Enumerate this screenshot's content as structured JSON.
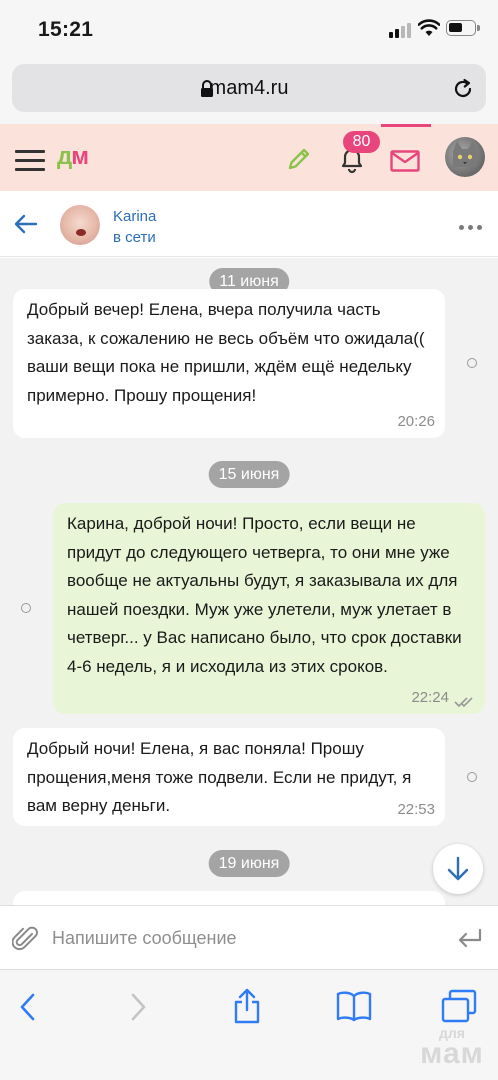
{
  "status_bar": {
    "time": "15:21"
  },
  "browser": {
    "url": "mam4.ru"
  },
  "site": {
    "logo_first": "д",
    "logo_second": "м",
    "notification_count": "80"
  },
  "chat_header": {
    "name": "Karina",
    "status": "в сети"
  },
  "messages": [
    {
      "type": "date",
      "text": "11 июня"
    },
    {
      "type": "in",
      "text": "Добрый вечер! Елена, вчера получила часть заказа, к сожалению не весь объём что ожидала(( ваши вещи пока не пришли, ждём ещё недельку примерно. Прошу прощения!",
      "time": "20:26"
    },
    {
      "type": "date",
      "text": "15 июня"
    },
    {
      "type": "out",
      "text": "Карина, доброй ночи! Просто, если вещи не придут до следующего четверга, то они мне уже вообще не актуальны будут, я заказывала их для нашей поездки. Муж уже улетели, муж улетает в четверг... у Вас написано было, что срок доставки 4-6 недель, я и исходила из этих сроков.",
      "time": "22:24"
    },
    {
      "type": "in",
      "text": "Добрый ночи! Елена, я вас поняла! Прошу прощения,меня тоже подвели. Если не придут, я вам верну деньги.",
      "time": "22:53"
    },
    {
      "type": "date",
      "text": "19 июня"
    }
  ],
  "compose": {
    "placeholder": "Напишите сообщение"
  },
  "watermark": {
    "line1": "для",
    "line2": "мам"
  },
  "colors": {
    "accent_pink": "#e8457c",
    "accent_green": "#8bc34a",
    "link_blue": "#2c6fb6",
    "outgoing_bubble": "#e8f5d6"
  }
}
